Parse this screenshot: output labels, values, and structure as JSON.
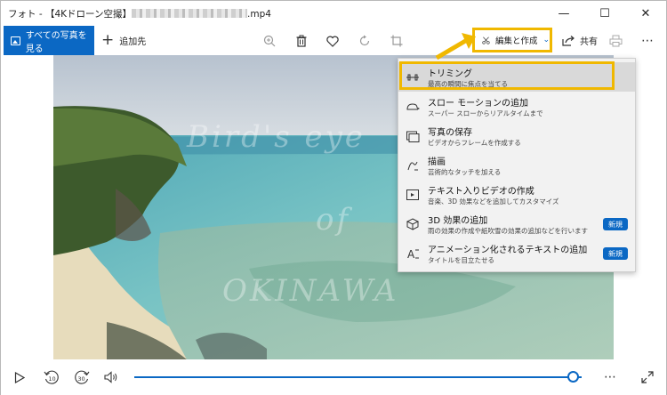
{
  "window": {
    "title_prefix": "フォト - 【4Kドローン空撮】",
    "title_suffix": ".mp4",
    "controls": {
      "minimize": "—",
      "maximize": "☐",
      "close": "✕"
    }
  },
  "toolbar": {
    "all_photos_label": "すべての写真を見る",
    "add_to_label": "追加先",
    "edit_create_label": "編集と作成",
    "share_label": "共有"
  },
  "menu": {
    "items": [
      {
        "icon": "trim-icon",
        "title": "トリミング",
        "subtitle": "最高の瞬間に焦点を当てる",
        "badge": ""
      },
      {
        "icon": "slow-motion-icon",
        "title": "スロー モーションの追加",
        "subtitle": "スーパー スローからリアルタイムまで",
        "badge": ""
      },
      {
        "icon": "save-photo-icon",
        "title": "写真の保存",
        "subtitle": "ビデオからフレームを作成する",
        "badge": ""
      },
      {
        "icon": "draw-icon",
        "title": "描画",
        "subtitle": "芸術的なタッチを加える",
        "badge": ""
      },
      {
        "icon": "text-video-icon",
        "title": "テキスト入りビデオの作成",
        "subtitle": "音楽、3D 効果などを追加してカスタマイズ",
        "badge": ""
      },
      {
        "icon": "3d-effects-icon",
        "title": "3D 効果の追加",
        "subtitle": "雨の効果の作成や紙吹雪の効果の追加などを行います",
        "badge": "新規"
      },
      {
        "icon": "animated-text-icon",
        "title": "アニメーション化されるテキストの追加",
        "subtitle": "タイトルを目立たせる",
        "badge": "新規"
      }
    ]
  },
  "video": {
    "watermark_line1": "Bird's eye",
    "watermark_line2": "of",
    "watermark_line3": "OKINAWA"
  },
  "playback": {
    "skip_back_label": "10",
    "skip_forward_label": "30",
    "progress_fraction": 0.98
  },
  "colors": {
    "accent": "#0b68c4",
    "highlight": "#f0b800"
  }
}
